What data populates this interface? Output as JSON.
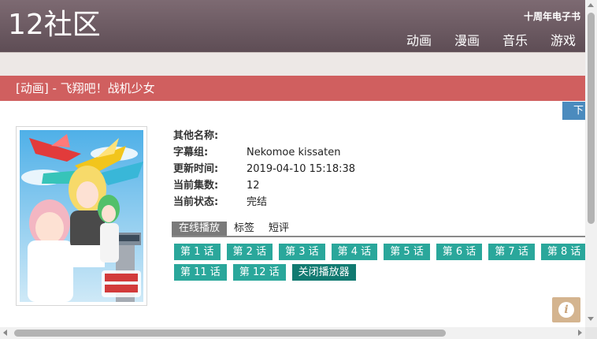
{
  "header": {
    "logo": "12社区",
    "ebook_link": "十周年电子书",
    "nav": [
      "动画",
      "漫画",
      "音乐",
      "游戏"
    ]
  },
  "title_bar": {
    "text": "[动画] - 飞翔吧！战机少女"
  },
  "download_tab": "下",
  "info": [
    {
      "label": "其他名称:",
      "value": ""
    },
    {
      "label": "字幕组:",
      "value": "Nekomoe kissaten"
    },
    {
      "label": "更新时间:",
      "value": "2019-04-10 15:18:38"
    },
    {
      "label": "当前集数:",
      "value": "12"
    },
    {
      "label": "当前状态:",
      "value": "完结"
    }
  ],
  "tabs": [
    {
      "label": "在线播放",
      "active": true
    },
    {
      "label": "标签",
      "active": false
    },
    {
      "label": "短评",
      "active": false
    }
  ],
  "episodes": {
    "row1": [
      "第 1 话",
      "第 2 话",
      "第 3 话",
      "第 4 话",
      "第 5 话",
      "第 6 话",
      "第 7 话",
      "第 8 话"
    ],
    "row2": [
      "第 11 话",
      "第 12 话"
    ],
    "close_label": "关闭播放器"
  },
  "colors": {
    "header": "#6d5b63",
    "title_bar": "#d05f5f",
    "episode_button": "#2aa79b",
    "close_button": "#117a71",
    "download_tab": "#4b8bbe",
    "info_button": "#d4b48f"
  },
  "icons": {
    "info_button": "info-icon"
  }
}
